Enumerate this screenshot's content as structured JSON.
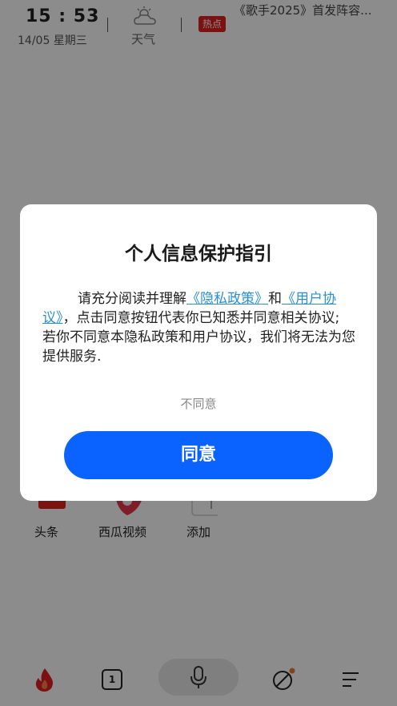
{
  "header": {
    "time_hour": "15",
    "time_sep": ":",
    "time_min": "53",
    "date": "14/05  星期三",
    "weather_label": "天气",
    "hot_badge": "热点",
    "headline": "《歌手2025》首发阵容..."
  },
  "apps": [
    {
      "label": "头条",
      "icon": "toutiao-icon"
    },
    {
      "label": "西瓜视频",
      "icon": "xigua-video-icon"
    },
    {
      "label": "添加",
      "icon": "add-icon"
    }
  ],
  "bottom_nav": {
    "items": [
      "hot-icon",
      "tabs-icon",
      "mic-icon",
      "discover-icon",
      "menu-icon"
    ],
    "tab_count": "1"
  },
  "dialog": {
    "title": "个人信息保护指引",
    "text_intro": "请充分阅读并理解",
    "link_privacy": "《隐私政策》",
    "text_and": "和",
    "link_user_agreement": "《用户协议》",
    "text_rest": "，点击同意按钮代表你已知悉并同意相关协议; 若你不同意本隐私政策和用户协议，我们将无法为您提供服务.",
    "disagree_label": "不同意",
    "agree_label": "同意"
  },
  "colors": {
    "accent": "#0a63ff",
    "link": "#2a8fd6",
    "hot": "#e02020"
  }
}
